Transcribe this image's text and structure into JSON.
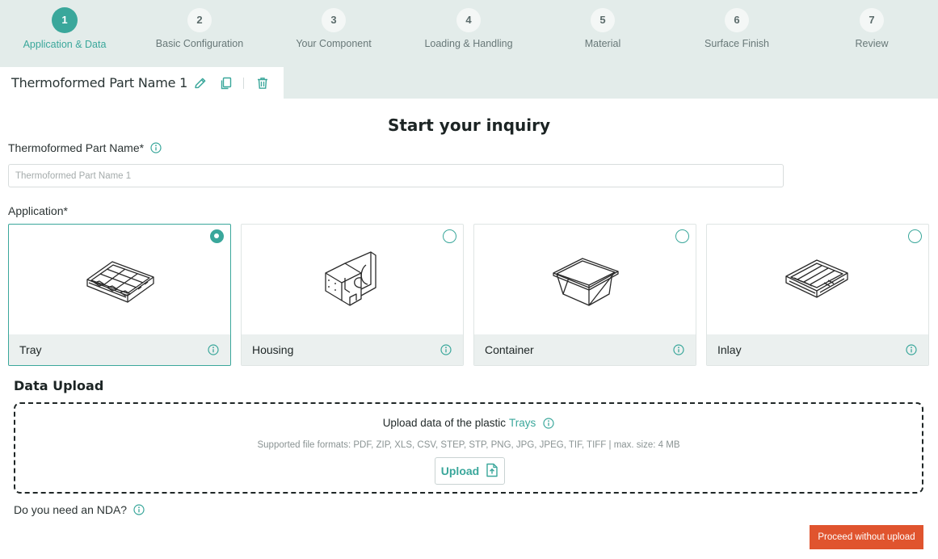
{
  "stepper": {
    "steps": [
      {
        "num": "1",
        "label": "Application & Data"
      },
      {
        "num": "2",
        "label": "Basic Configuration"
      },
      {
        "num": "3",
        "label": "Your Component"
      },
      {
        "num": "4",
        "label": "Loading & Handling"
      },
      {
        "num": "5",
        "label": "Material"
      },
      {
        "num": "6",
        "label": "Surface Finish"
      },
      {
        "num": "7",
        "label": "Review"
      }
    ],
    "active_step": "1"
  },
  "part_tab": {
    "name": "Thermoformed Part Name 1",
    "icons": [
      "pencil-icon",
      "copy-icon",
      "trash-icon"
    ]
  },
  "page": {
    "title": "Start your inquiry"
  },
  "part_name_field": {
    "label": "Thermoformed Part Name*",
    "placeholder": "Thermoformed Part Name 1",
    "value": ""
  },
  "application": {
    "label": "Application*",
    "selected": "Tray",
    "options": [
      {
        "name": "Tray",
        "icon": "tray-icon"
      },
      {
        "name": "Housing",
        "icon": "housing-icon"
      },
      {
        "name": "Container",
        "icon": "container-icon"
      },
      {
        "name": "Inlay",
        "icon": "inlay-icon"
      }
    ]
  },
  "upload": {
    "section_title": "Data Upload",
    "prompt_text": "Upload data of the plastic",
    "prompt_link": "Trays",
    "formats": "Supported file formats: PDF, ZIP, XLS, CSV, STEP, STP, PNG, JPG, JPEG, TIF, TIFF | max. size: 4 MB",
    "button_label": "Upload"
  },
  "nda": {
    "label": "Do you need an NDA?"
  },
  "actions": {
    "proceed_label": "Proceed without upload"
  },
  "colors": {
    "accent": "#3aa79b",
    "stepper_bg": "#e3ecea",
    "card_footer_bg": "#ebf0ef",
    "proceed_bg": "#e0542e"
  }
}
